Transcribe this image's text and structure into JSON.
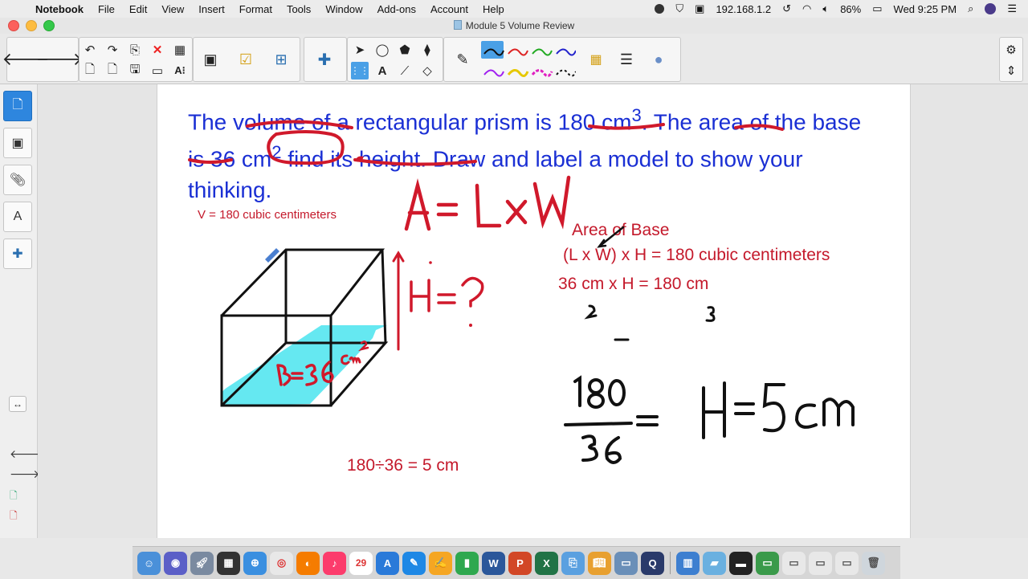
{
  "menubar": {
    "app_name": "Notebook",
    "items": [
      "File",
      "Edit",
      "View",
      "Insert",
      "Format",
      "Tools",
      "Window",
      "Add-ons",
      "Account",
      "Help"
    ],
    "ip": "192.168.1.2",
    "battery": "86%",
    "clock": "Wed 9:25 PM"
  },
  "window": {
    "title": "Module 5 Volume Review"
  },
  "page": {
    "question_part1": "The volume of a rectangular prism is 180 cm",
    "question_sup1": "3",
    "question_part2": ". The area of the base is 36 cm",
    "question_sup2": "2",
    "question_part3": " find its height. Draw and label a model to show your thinking.",
    "volume_note": "V = 180 cubic centimeters",
    "area_of_base": "Area of Base",
    "formula_line": "(L x W) x H = 180 cubic centimeters",
    "substitution_line": "36 cm x H = 180 cm",
    "division_line": "180÷36 = 5 cm",
    "handwriting": {
      "a_formula": "A= LxW",
      "h_question": "H=?",
      "base_label": "B=36cm²",
      "fraction_num": "180",
      "fraction_den": "36",
      "h_result": "H=5cm",
      "exp_2": "2",
      "exp_3": "3"
    }
  },
  "dock": {
    "calendar_day": "29"
  },
  "colors": {
    "question_blue": "#1a2fd4",
    "ink_red": "#c4192b",
    "base_fill": "#54e6f0",
    "tool_selected": "#4aa0e6"
  }
}
